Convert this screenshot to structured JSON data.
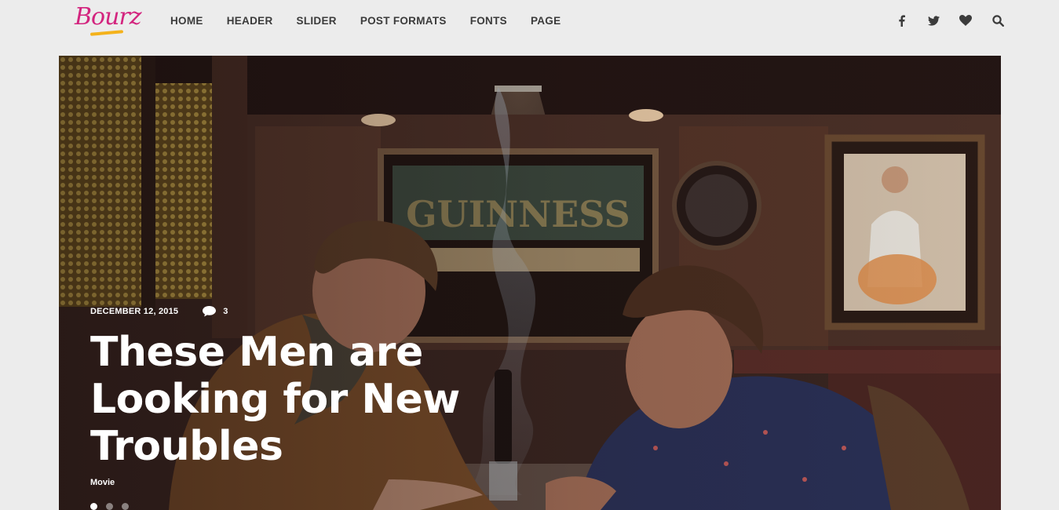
{
  "header": {
    "logo": "Bourz",
    "nav": [
      "HOME",
      "HEADER",
      "SLIDER",
      "POST FORMATS",
      "FONTS",
      "PAGE"
    ],
    "social_icons": [
      "facebook-icon",
      "twitter-icon",
      "heart-icon",
      "search-icon"
    ]
  },
  "slide": {
    "date": "DECEMBER 12, 2015",
    "comments": "3",
    "title": "These Men are Looking for New Troubles",
    "category": "Movie",
    "dots_total": 3,
    "active_dot": 1
  },
  "colors": {
    "brand": "#d3247e",
    "accent": "#f4b21b",
    "nav_text": "#3b3b3b",
    "background": "#ececec"
  }
}
